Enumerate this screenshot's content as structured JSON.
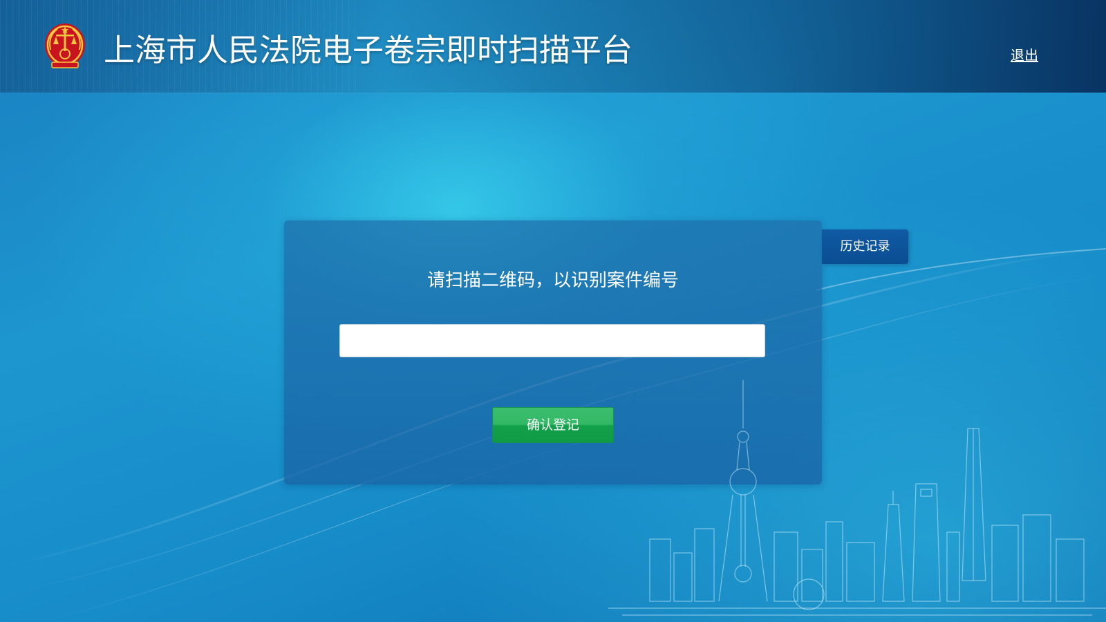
{
  "header": {
    "title": "上海市人民法院电子卷宗即时扫描平台",
    "logout_label": "退出",
    "emblem_icon": "court-emblem-icon"
  },
  "main": {
    "prompt": "请扫描二维码，以识别案件编号",
    "scan_input": {
      "value": "",
      "placeholder": ""
    },
    "confirm_label": "确认登记",
    "history_label": "历史记录"
  },
  "colors": {
    "accent_green": "#13a04a",
    "tab_blue": "#0a4d92",
    "background_blue": "#1d96cf"
  }
}
